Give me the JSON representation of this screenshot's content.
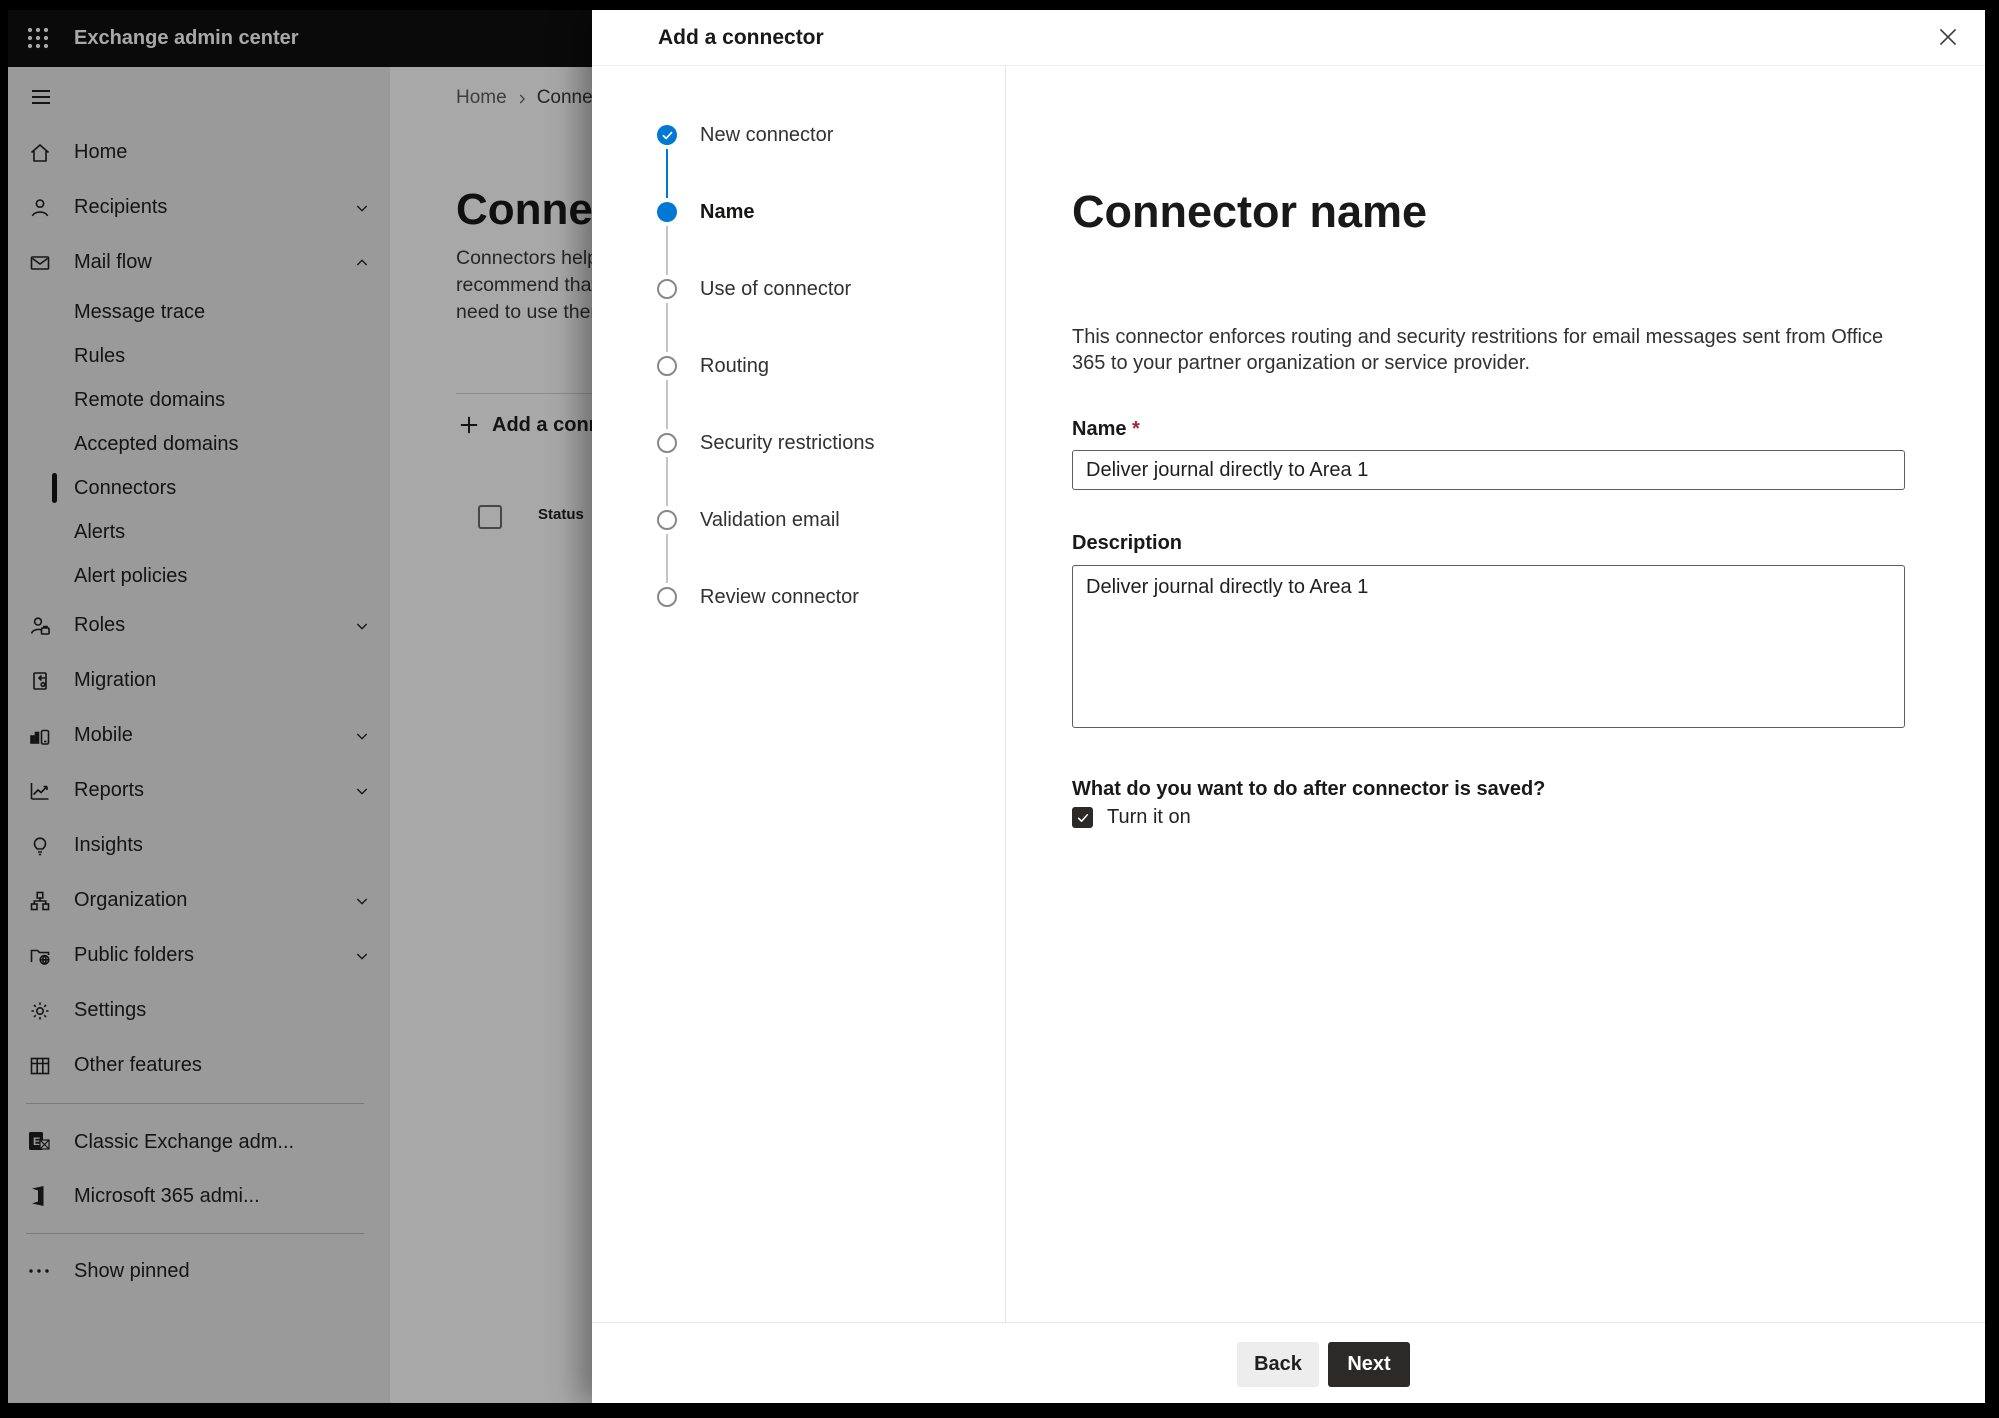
{
  "header": {
    "app_title": "Exchange admin center"
  },
  "sidebar": {
    "items": [
      {
        "label": "Home"
      },
      {
        "label": "Recipients"
      },
      {
        "label": "Mail flow"
      },
      {
        "label": "Message trace"
      },
      {
        "label": "Rules"
      },
      {
        "label": "Remote domains"
      },
      {
        "label": "Accepted domains"
      },
      {
        "label": "Connectors",
        "selected": true
      },
      {
        "label": "Alerts"
      },
      {
        "label": "Alert policies"
      },
      {
        "label": "Roles"
      },
      {
        "label": "Migration"
      },
      {
        "label": "Mobile"
      },
      {
        "label": "Reports"
      },
      {
        "label": "Insights"
      },
      {
        "label": "Organization"
      },
      {
        "label": "Public folders"
      },
      {
        "label": "Settings"
      },
      {
        "label": "Other features"
      }
    ],
    "classic_admin_label": "Classic Exchange adm...",
    "m365_admin_label": "Microsoft 365 admi...",
    "show_pinned_label": "Show pinned"
  },
  "page": {
    "breadcrumb": {
      "home": "Home",
      "current": "Connectors"
    },
    "title": "Connectors",
    "intro_lines": {
      "l1": "Connectors help",
      "l2": "recommend that",
      "l3": "need to use ther"
    },
    "add_button_label": "Add a connector",
    "status_column_label": "Status"
  },
  "dialog": {
    "title": "Add a connector",
    "steps": [
      {
        "label": "New connector",
        "state": "completed"
      },
      {
        "label": "Name",
        "state": "current"
      },
      {
        "label": "Use of connector",
        "state": "upcoming"
      },
      {
        "label": "Routing",
        "state": "upcoming"
      },
      {
        "label": "Security restrictions",
        "state": "upcoming"
      },
      {
        "label": "Validation email",
        "state": "upcoming"
      },
      {
        "label": "Review connector",
        "state": "upcoming"
      }
    ],
    "content": {
      "heading": "Connector name",
      "description": "This connector enforces routing and security restritions for email messages sent from Office 365 to your partner organization or service provider.",
      "name_label": "Name",
      "required_marker": "*",
      "name_value": "Deliver journal directly to Area 1",
      "description_label": "Description",
      "description_value": "Deliver journal directly to Area 1",
      "after_save_question": "What do you want to do after connector is saved?",
      "turn_on_label": "Turn it on",
      "turn_on_checked": true
    },
    "footer": {
      "back_label": "Back",
      "next_label": "Next"
    }
  },
  "colors": {
    "accent_blue": "#0078d4",
    "topbar_bg": "#101010",
    "primary_button_bg": "#2b2a29",
    "required_red": "#a4262c",
    "sidebar_bg": "#eaeaea"
  }
}
